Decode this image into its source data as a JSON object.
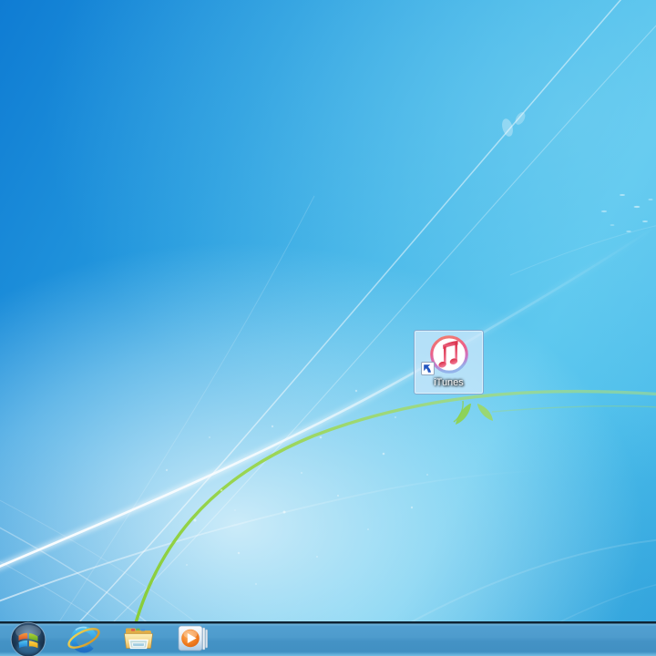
{
  "desktop": {
    "icons": [
      {
        "label": "iTunes",
        "type": "shortcut",
        "selected": true,
        "icon": "itunes-icon"
      }
    ]
  },
  "taskbar": {
    "items": [
      {
        "name": "start-button",
        "icon": "windows-logo-icon"
      },
      {
        "name": "internet-explorer",
        "icon": "internet-explorer-icon"
      },
      {
        "name": "windows-explorer",
        "icon": "folder-icon"
      },
      {
        "name": "windows-media-player",
        "icon": "media-player-icon"
      }
    ]
  },
  "colors": {
    "wallpaper_top_left": "#0f7cd3",
    "wallpaper_cyan": "#55c5ee",
    "wallpaper_glow": "#f0fbfe",
    "green_swoosh": "#8fd149",
    "taskbar_blue": "#4a97c9",
    "taskbar_border_dark": "#0e2334",
    "selection_fill": "#d5ebfc",
    "selection_border": "#80a8cd",
    "itunes_note_red": "#d92e47",
    "itunes_ring_pink": "#ed5f87",
    "label_text": "#ffffff"
  }
}
